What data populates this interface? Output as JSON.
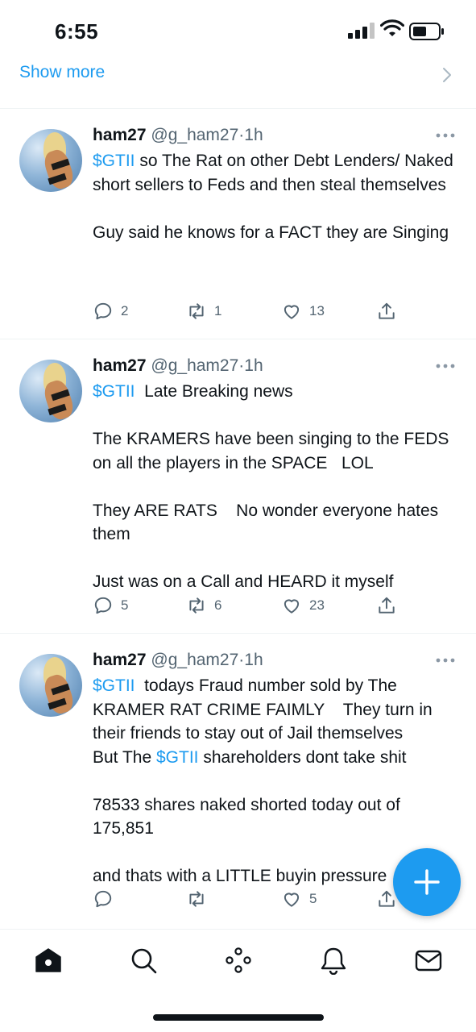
{
  "status_bar": {
    "time": "6:55"
  },
  "show_more": {
    "label": "Show more"
  },
  "tweets": [
    {
      "name": "ham27",
      "handle": "@g_ham27",
      "separator": "·",
      "time": "1h",
      "paragraphs": [
        [
          {
            "t": "$GTII",
            "tag": true
          },
          {
            "t": " so The Rat on other Debt Lenders/ Naked short sellers to Feds and then steal themselves"
          }
        ],
        [
          {
            "t": "Guy said he knows for a FACT they are Singing"
          }
        ]
      ],
      "stats": {
        "replies": "2",
        "retweets": "1",
        "likes": "13"
      }
    },
    {
      "name": "ham27",
      "handle": "@g_ham27",
      "separator": "·",
      "time": "1h",
      "paragraphs": [
        [
          {
            "t": "$GTII",
            "tag": true
          },
          {
            "t": "  Late Breaking news"
          }
        ],
        [
          {
            "t": "The KRAMERS have been singing to the FEDS on all the players in the SPACE   LOL"
          }
        ],
        [
          {
            "t": "They ARE RATS    No wonder everyone hates them"
          }
        ],
        [
          {
            "t": "Just was on a Call and HEARD it myself"
          }
        ]
      ],
      "stats": {
        "replies": "5",
        "retweets": "6",
        "likes": "23"
      }
    },
    {
      "name": "ham27",
      "handle": "@g_ham27",
      "separator": "·",
      "time": "1h",
      "paragraphs": [
        [
          {
            "t": "$GTII",
            "tag": true
          },
          {
            "t": "  todays Fraud number sold by The KRAMER RAT CRIME FAIMLY    They turn in their friends to stay out of Jail themselves\nBut The "
          },
          {
            "t": "$GTII",
            "tag": true
          },
          {
            "t": " shareholders dont take shit"
          }
        ],
        [
          {
            "t": "78533 shares naked shorted today out of 175,851"
          }
        ],
        [
          {
            "t": "and thats with a LITTLE buyin pressure"
          }
        ]
      ],
      "stats": {
        "replies": "",
        "retweets": "",
        "likes": "5"
      }
    }
  ],
  "icons": {
    "status": [
      "signal-icon",
      "wifi-icon",
      "battery-icon"
    ],
    "actions": [
      "reply-icon",
      "retweet-icon",
      "like-icon",
      "share-icon"
    ],
    "nav": [
      "home-icon",
      "search-icon",
      "spaces-icon",
      "notifications-icon",
      "messages-icon"
    ],
    "fab": "compose-plus-icon"
  },
  "colors": {
    "accent": "#1d9bf0",
    "text": "#0f1419",
    "secondary": "#536471",
    "divider": "#eff3f4"
  }
}
